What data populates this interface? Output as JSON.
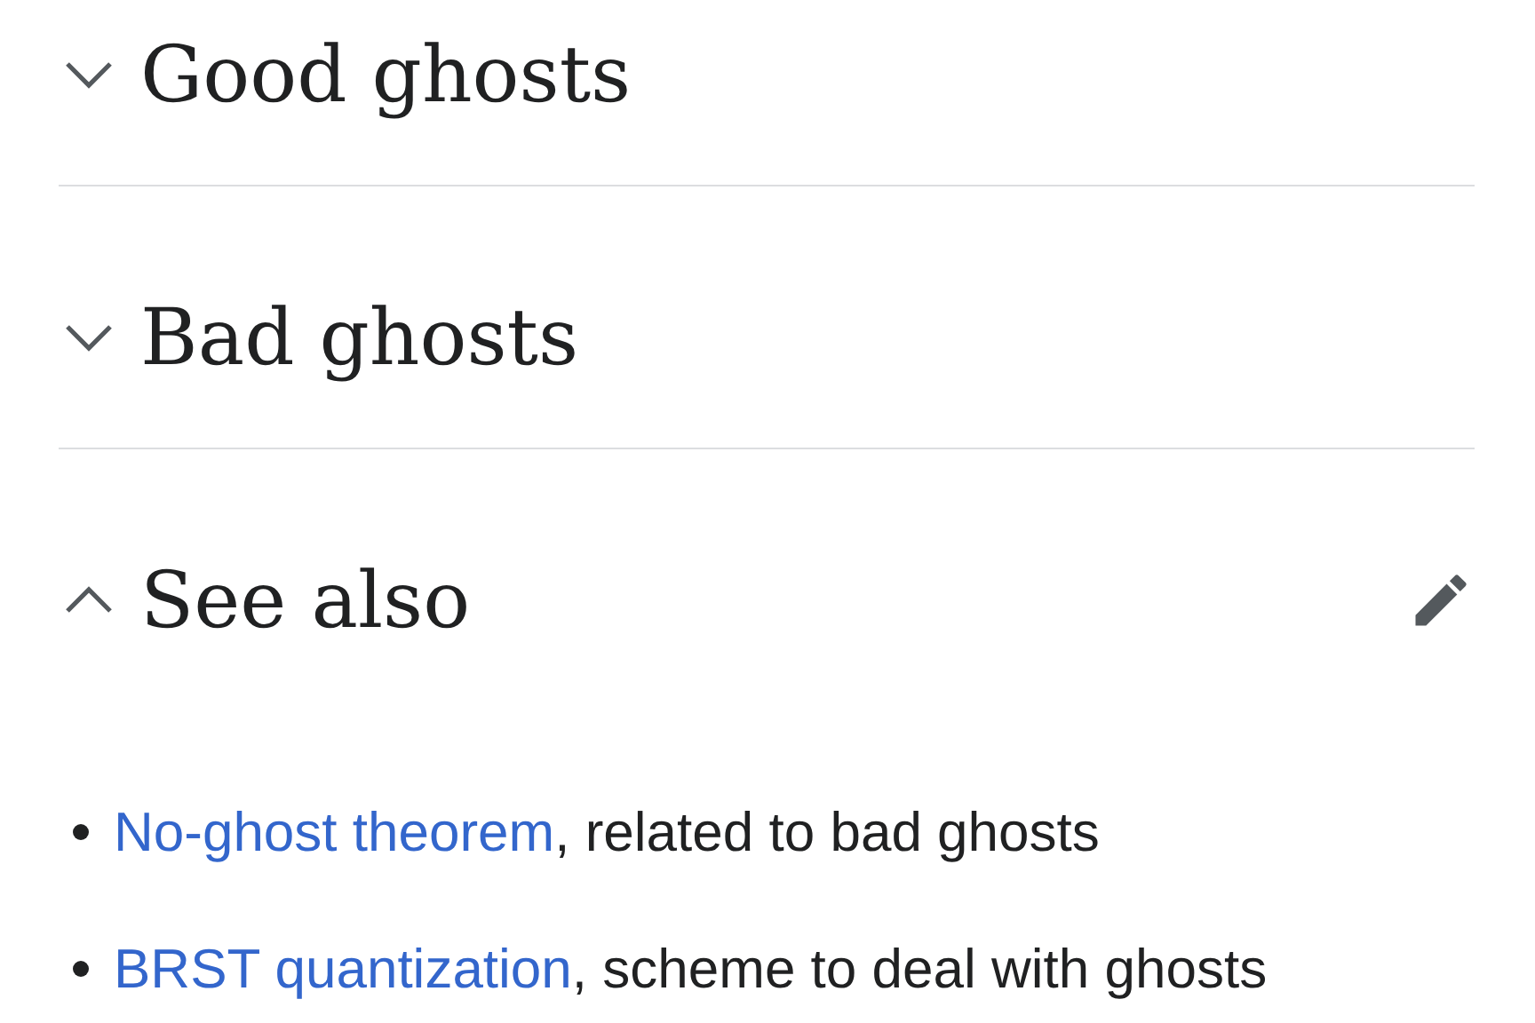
{
  "sections": [
    {
      "title": "Good ghosts",
      "expanded": false
    },
    {
      "title": "Bad ghosts",
      "expanded": false
    },
    {
      "title": "See also",
      "expanded": true,
      "items": [
        {
          "link": "No-ghost theorem",
          "text": ", related to bad ghosts"
        },
        {
          "link": "BRST quantization",
          "text": ", scheme to deal with ghosts"
        }
      ]
    }
  ]
}
